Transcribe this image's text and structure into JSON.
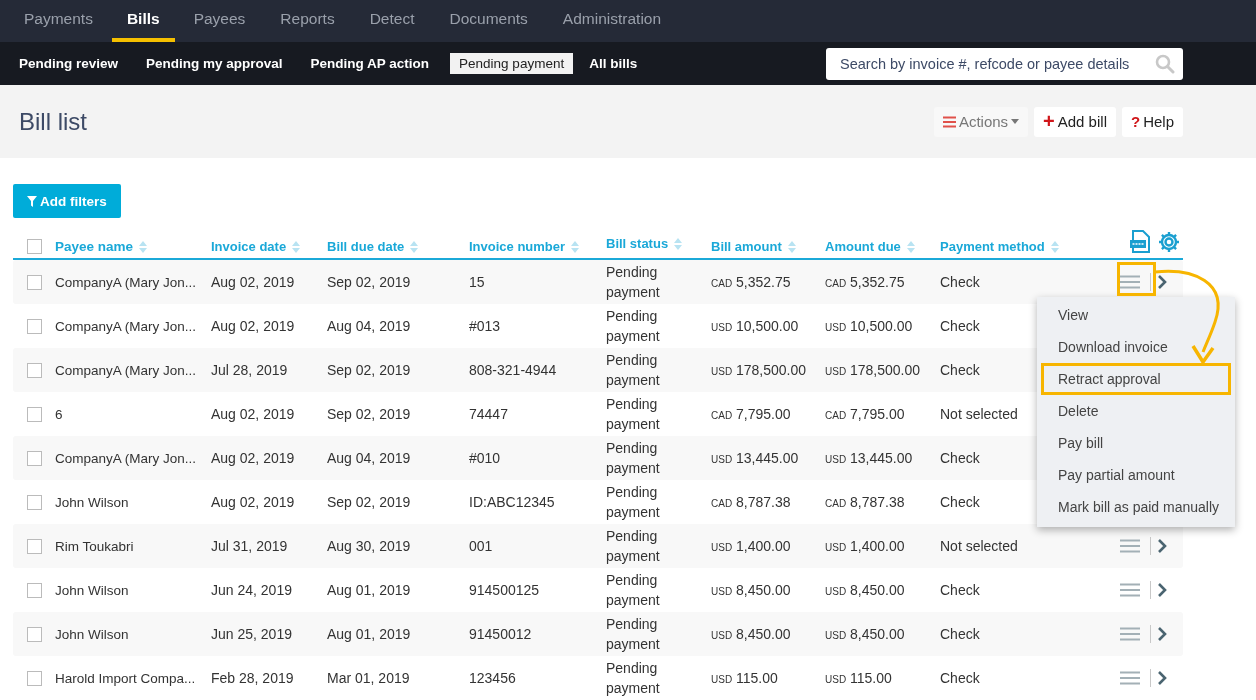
{
  "main_nav": [
    {
      "label": "Payments",
      "selected": false
    },
    {
      "label": "Bills",
      "selected": true
    },
    {
      "label": "Payees",
      "selected": false
    },
    {
      "label": "Reports",
      "selected": false
    },
    {
      "label": "Detect",
      "selected": false
    },
    {
      "label": "Documents",
      "selected": false
    },
    {
      "label": "Administration",
      "selected": false
    }
  ],
  "sub_nav": [
    {
      "label": "Pending review",
      "selected": false
    },
    {
      "label": "Pending my approval",
      "selected": false
    },
    {
      "label": "Pending AP action",
      "selected": false
    },
    {
      "label": "Pending payment",
      "selected": true
    },
    {
      "label": "All bills",
      "selected": false
    }
  ],
  "search": {
    "placeholder": "Search by invoice #, refcode or payee details"
  },
  "page_title": "Bill list",
  "header_buttons": [
    {
      "kind": "actions",
      "label": "Actions"
    },
    {
      "kind": "add",
      "label": "Add bill",
      "icon": "+"
    },
    {
      "kind": "help",
      "label": "Help",
      "icon": "?"
    }
  ],
  "filter_button": "Add filters",
  "table": {
    "select_all_checked": false,
    "columns": [
      "Payee name",
      "Invoice date",
      "Bill due date",
      "Invoice number",
      "Bill status",
      "Bill amount",
      "Amount due",
      "Payment method"
    ],
    "rows": [
      {
        "payee": "CompanyA (Mary Jon...",
        "invoice_date": "Aug 02, 2019",
        "due_date": "Sep 02, 2019",
        "invoice_number": "15",
        "status": "Pending payment",
        "bill_currency": "CAD",
        "bill_amount": "5,352.75",
        "due_currency": "CAD",
        "amount_due": "5,352.75",
        "method": "Check",
        "checked": false
      },
      {
        "payee": "CompanyA (Mary Jon...",
        "invoice_date": "Aug 02, 2019",
        "due_date": "Aug 04, 2019",
        "invoice_number": "#013",
        "status": "Pending payment",
        "bill_currency": "USD",
        "bill_amount": "10,500.00",
        "due_currency": "USD",
        "amount_due": "10,500.00",
        "method": "Check",
        "checked": false
      },
      {
        "payee": "CompanyA (Mary Jon...",
        "invoice_date": "Jul 28, 2019",
        "due_date": "Sep 02, 2019",
        "invoice_number": "808-321-4944",
        "status": "Pending payment",
        "bill_currency": "USD",
        "bill_amount": "178,500.00",
        "due_currency": "USD",
        "amount_due": "178,500.00",
        "method": "Check",
        "checked": false
      },
      {
        "payee": "6",
        "invoice_date": "Aug 02, 2019",
        "due_date": "Sep 02, 2019",
        "invoice_number": "74447",
        "status": "Pending payment",
        "bill_currency": "CAD",
        "bill_amount": "7,795.00",
        "due_currency": "CAD",
        "amount_due": "7,795.00",
        "method": "Not selected",
        "checked": false
      },
      {
        "payee": "CompanyA (Mary Jon...",
        "invoice_date": "Aug 02, 2019",
        "due_date": "Aug 04, 2019",
        "invoice_number": "#010",
        "status": "Pending payment",
        "bill_currency": "USD",
        "bill_amount": "13,445.00",
        "due_currency": "USD",
        "amount_due": "13,445.00",
        "method": "Check",
        "checked": false
      },
      {
        "payee": "John Wilson",
        "invoice_date": "Aug 02, 2019",
        "due_date": "Sep 02, 2019",
        "invoice_number": "ID:ABC12345",
        "status": "Pending payment",
        "bill_currency": "CAD",
        "bill_amount": "8,787.38",
        "due_currency": "CAD",
        "amount_due": "8,787.38",
        "method": "Check",
        "checked": false
      },
      {
        "payee": "Rim Toukabri",
        "invoice_date": "Jul 31, 2019",
        "due_date": "Aug 30, 2019",
        "invoice_number": "001",
        "status": "Pending payment",
        "bill_currency": "USD",
        "bill_amount": "1,400.00",
        "due_currency": "USD",
        "amount_due": "1,400.00",
        "method": "Not selected",
        "checked": false
      },
      {
        "payee": "John Wilson",
        "invoice_date": "Jun 24, 2019",
        "due_date": "Aug 01, 2019",
        "invoice_number": "914500125",
        "status": "Pending payment",
        "bill_currency": "USD",
        "bill_amount": "8,450.00",
        "due_currency": "USD",
        "amount_due": "8,450.00",
        "method": "Check",
        "checked": false
      },
      {
        "payee": "John Wilson",
        "invoice_date": "Jun 25, 2019",
        "due_date": "Aug 01, 2019",
        "invoice_number": "91450012",
        "status": "Pending payment",
        "bill_currency": "USD",
        "bill_amount": "8,450.00",
        "due_currency": "USD",
        "amount_due": "8,450.00",
        "method": "Check",
        "checked": false
      },
      {
        "payee": "Harold Import Compa...",
        "invoice_date": "Feb 28, 2019",
        "due_date": "Mar 01, 2019",
        "invoice_number": "123456",
        "status": "Pending payment",
        "bill_currency": "USD",
        "bill_amount": "115.00",
        "due_currency": "USD",
        "amount_due": "115.00",
        "method": "Check",
        "checked": false
      }
    ]
  },
  "row_menu": [
    {
      "label": "View",
      "highlighted": false
    },
    {
      "label": "Download invoice",
      "highlighted": false
    },
    {
      "label": "Retract approval",
      "highlighted": true
    },
    {
      "label": "Delete",
      "highlighted": false
    },
    {
      "label": "Pay bill",
      "highlighted": false
    },
    {
      "label": "Pay partial amount",
      "highlighted": false
    },
    {
      "label": "Mark bill as paid manually",
      "highlighted": false
    }
  ]
}
